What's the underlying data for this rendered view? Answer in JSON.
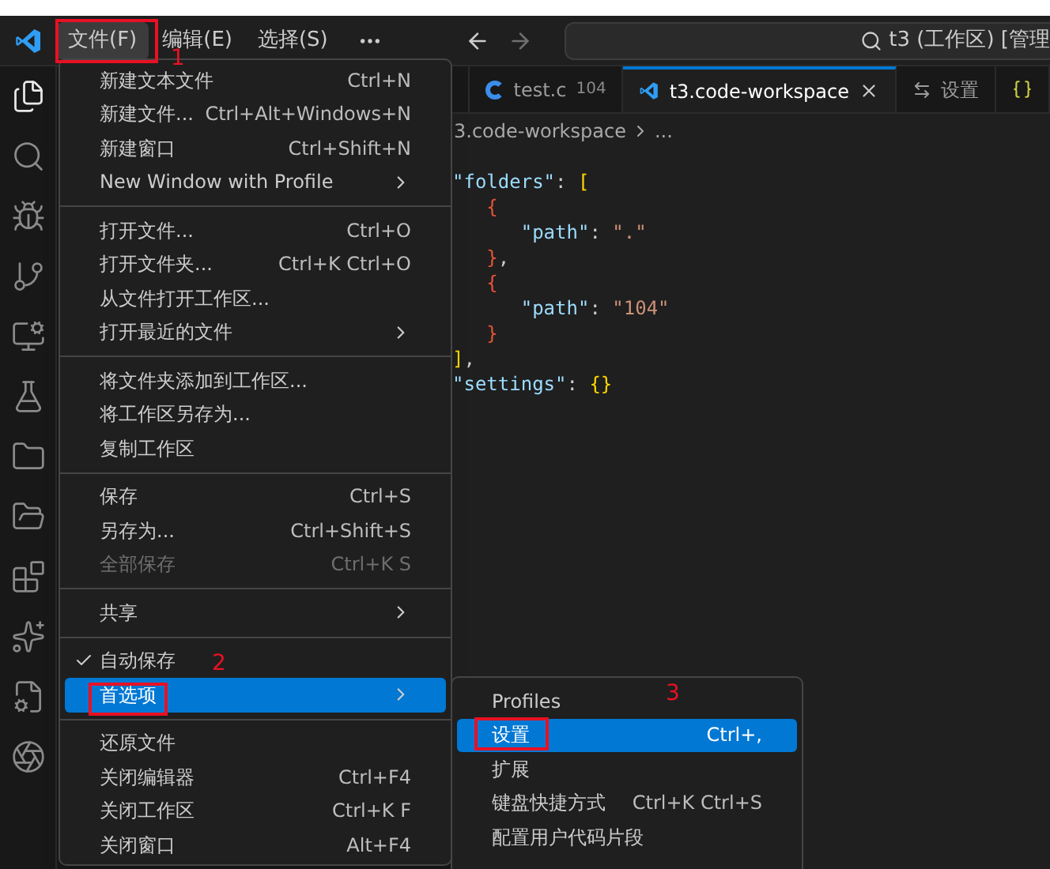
{
  "menu_bar": {
    "items": [
      {
        "label": "文件(F)",
        "selected": true
      },
      {
        "label": "编辑(E)",
        "selected": false
      },
      {
        "label": "选择(S)",
        "selected": false
      }
    ]
  },
  "command_center": {
    "text": "t3 (工作区) [管理"
  },
  "activity_bar": {
    "items": [
      {
        "selected": true
      },
      {
        "selected": false
      },
      {
        "selected": false
      },
      {
        "selected": false
      },
      {
        "selected": false
      },
      {
        "selected": false
      },
      {
        "selected": false
      },
      {
        "selected": false
      },
      {
        "selected": false
      },
      {
        "selected": false
      },
      {
        "selected": false
      },
      {
        "selected": false
      }
    ]
  },
  "tabs": [
    {
      "kind": "c",
      "label": "test.c",
      "detail": "104",
      "selected": false
    },
    {
      "kind": "workspace",
      "label": "t3.code-workspace",
      "selected": true
    },
    {
      "kind": "settings",
      "label": "设置",
      "selected": false
    },
    {
      "kind": "json",
      "selected": false
    }
  ],
  "breadcrumb": [
    "3.code-workspace",
    "..."
  ],
  "code_lines": [
    [
      {
        "text": "\"folders\"",
        "kind": "key"
      },
      {
        "text": ": ",
        "kind": "plain"
      },
      {
        "text": "[",
        "kind": "bracket"
      }
    ],
    [
      {
        "text": "   {",
        "kind": "brace"
      }
    ],
    [
      {
        "text": "      \"path\"",
        "kind": "key"
      },
      {
        "text": ": ",
        "kind": "plain"
      },
      {
        "text": "\".\"",
        "kind": "string"
      }
    ],
    [
      {
        "text": "   }",
        "kind": "brace"
      },
      {
        "text": ",",
        "kind": "plain"
      }
    ],
    [
      {
        "text": "   {",
        "kind": "brace"
      }
    ],
    [
      {
        "text": "      \"path\"",
        "kind": "key"
      },
      {
        "text": ": ",
        "kind": "plain"
      },
      {
        "text": "\"104\"",
        "kind": "string"
      }
    ],
    [
      {
        "text": "   }",
        "kind": "brace"
      }
    ],
    [
      {
        "text": "]",
        "kind": "bracket"
      },
      {
        "text": ",",
        "kind": "plain"
      }
    ],
    [
      {
        "text": "\"settings\"",
        "kind": "key"
      },
      {
        "text": ": ",
        "kind": "plain"
      },
      {
        "text": "{}",
        "kind": "bracket"
      }
    ]
  ],
  "file_menu": {
    "groups": [
      [
        {
          "label": "新建文本文件",
          "shortcut": "Ctrl+N",
          "submenu": false,
          "checked": false,
          "disabled": false,
          "selected": false
        },
        {
          "label": "新建文件...",
          "shortcut": "Ctrl+Alt+Windows+N",
          "submenu": false,
          "checked": false,
          "disabled": false,
          "selected": false
        },
        {
          "label": "新建窗口",
          "shortcut": "Ctrl+Shift+N",
          "submenu": false,
          "checked": false,
          "disabled": false,
          "selected": false
        },
        {
          "label": "New Window with Profile",
          "submenu": true,
          "checked": false,
          "disabled": false,
          "selected": false
        }
      ],
      [
        {
          "label": "打开文件...",
          "shortcut": "Ctrl+O",
          "submenu": false,
          "checked": false,
          "disabled": false,
          "selected": false
        },
        {
          "label": "打开文件夹...",
          "shortcut": "Ctrl+K Ctrl+O",
          "submenu": false,
          "checked": false,
          "disabled": false,
          "selected": false
        },
        {
          "label": "从文件打开工作区...",
          "submenu": false,
          "checked": false,
          "disabled": false,
          "selected": false
        },
        {
          "label": "打开最近的文件",
          "submenu": true,
          "checked": false,
          "disabled": false,
          "selected": false
        }
      ],
      [
        {
          "label": "将文件夹添加到工作区...",
          "submenu": false,
          "checked": false,
          "disabled": false,
          "selected": false
        },
        {
          "label": "将工作区另存为...",
          "submenu": false,
          "checked": false,
          "disabled": false,
          "selected": false
        },
        {
          "label": "复制工作区",
          "submenu": false,
          "checked": false,
          "disabled": false,
          "selected": false
        }
      ],
      [
        {
          "label": "保存",
          "shortcut": "Ctrl+S",
          "submenu": false,
          "checked": false,
          "disabled": false,
          "selected": false
        },
        {
          "label": "另存为...",
          "shortcut": "Ctrl+Shift+S",
          "submenu": false,
          "checked": false,
          "disabled": false,
          "selected": false
        },
        {
          "label": "全部保存",
          "shortcut": "Ctrl+K S",
          "submenu": false,
          "checked": false,
          "disabled": true,
          "selected": false
        }
      ],
      [
        {
          "label": "共享",
          "submenu": true,
          "checked": false,
          "disabled": false,
          "selected": false
        }
      ],
      [
        {
          "label": "自动保存",
          "submenu": false,
          "checked": true,
          "disabled": false,
          "selected": false
        },
        {
          "label": "首选项",
          "submenu": true,
          "checked": false,
          "disabled": false,
          "selected": true
        }
      ],
      [
        {
          "label": "还原文件",
          "submenu": false,
          "checked": false,
          "disabled": false,
          "selected": false
        },
        {
          "label": "关闭编辑器",
          "shortcut": "Ctrl+F4",
          "submenu": false,
          "checked": false,
          "disabled": false,
          "selected": false
        },
        {
          "label": "关闭工作区",
          "shortcut": "Ctrl+K F",
          "submenu": false,
          "checked": false,
          "disabled": false,
          "selected": false
        },
        {
          "label": "关闭窗口",
          "shortcut": "Alt+F4",
          "submenu": false,
          "checked": false,
          "disabled": false,
          "selected": false
        }
      ]
    ]
  },
  "preferences_submenu": {
    "items": [
      {
        "label": "Profiles",
        "selected": false
      },
      {
        "label": "设置",
        "shortcut": "Ctrl+,",
        "selected": true
      },
      {
        "label": "扩展",
        "selected": false
      },
      {
        "label": "键盘快捷方式",
        "shortcut": "Ctrl+K Ctrl+S",
        "selected": false
      },
      {
        "label": "配置用户代码片段",
        "selected": false
      }
    ]
  },
  "annotations": [
    {
      "number": "1"
    },
    {
      "number": "2"
    },
    {
      "number": "3"
    }
  ]
}
